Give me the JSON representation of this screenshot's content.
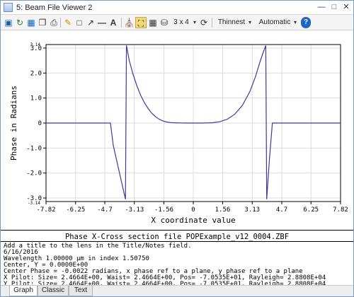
{
  "window": {
    "title": "5: Beam File Viewer 2"
  },
  "toolbar": {
    "layout_label": "3 x 4",
    "line_label": "Thinnest",
    "scale_label": "Automatic"
  },
  "chart_data": {
    "type": "line",
    "xlabel": "X coordinate value",
    "ylabel": "Phase in Radians",
    "xlim": [
      -7.82,
      7.82
    ],
    "ylim": [
      -3.14,
      3.14
    ],
    "xticks": [
      "-7.82",
      "-6.25",
      "-4.7",
      "-3.13",
      "-1.56",
      "0",
      "1.56",
      "3.13",
      "4.7",
      "6.25",
      "7.82"
    ],
    "yticks": [
      "3.0",
      "2.0",
      "1.0",
      "0",
      "-1.0",
      "-2.0",
      "-3.0"
    ],
    "ylim_labels": [
      "3.14",
      "-3.14"
    ],
    "grid": true,
    "series": [
      {
        "color": "#3a3aa0",
        "x": [
          -7.82,
          -4.4,
          -4.25,
          -3.6,
          -3.55,
          -3.4,
          -3.2,
          -3.0,
          -2.8,
          -2.6,
          -2.4,
          -2.2,
          -2.0,
          -1.8,
          -1.6,
          -1.4,
          -1.2,
          -1.0,
          -0.5,
          0,
          0.5,
          1.0,
          1.4,
          1.8,
          2.2,
          2.6,
          3.0,
          3.3,
          3.5,
          3.7,
          3.85,
          3.9,
          4.05,
          4.2,
          7.82
        ],
        "y": [
          0,
          0,
          -0.9,
          -3.05,
          3.1,
          2.5,
          1.95,
          1.5,
          1.12,
          0.82,
          0.58,
          0.39,
          0.25,
          0.15,
          0.08,
          0.04,
          0.02,
          0.01,
          0,
          0,
          0,
          0.01,
          0.05,
          0.15,
          0.35,
          0.7,
          1.25,
          1.85,
          2.35,
          2.8,
          3.1,
          -3.05,
          -1.4,
          0,
          0
        ]
      }
    ]
  },
  "info_panel": {
    "title": "Phase X-Cross section file POPExample_v12_0004.ZBF",
    "lines": [
      "Add a title to the lens in the Title/Notes field.",
      "6/16/2016",
      "Wavelength 1.00000 µm in index 1.50750",
      "Center, Y = 0.0000E+00",
      "Center Phase = -0.0022 radians, x phase ref to a plane, y phase ref to a plane",
      "X Pilot: Size= 2.4664E+00, Waist= 2.4664E+00, Pos= -7.0535E+01, Rayleigh= 2.8808E+04",
      "Y Pilot: Size= 2.4664E+00, Waist= 2.4664E+00, Pos= -7.0535E+01, Rayleigh= 2.8808E+04"
    ]
  },
  "tabs": [
    {
      "label": "Graph"
    },
    {
      "label": "Classic"
    },
    {
      "label": "Text"
    }
  ]
}
